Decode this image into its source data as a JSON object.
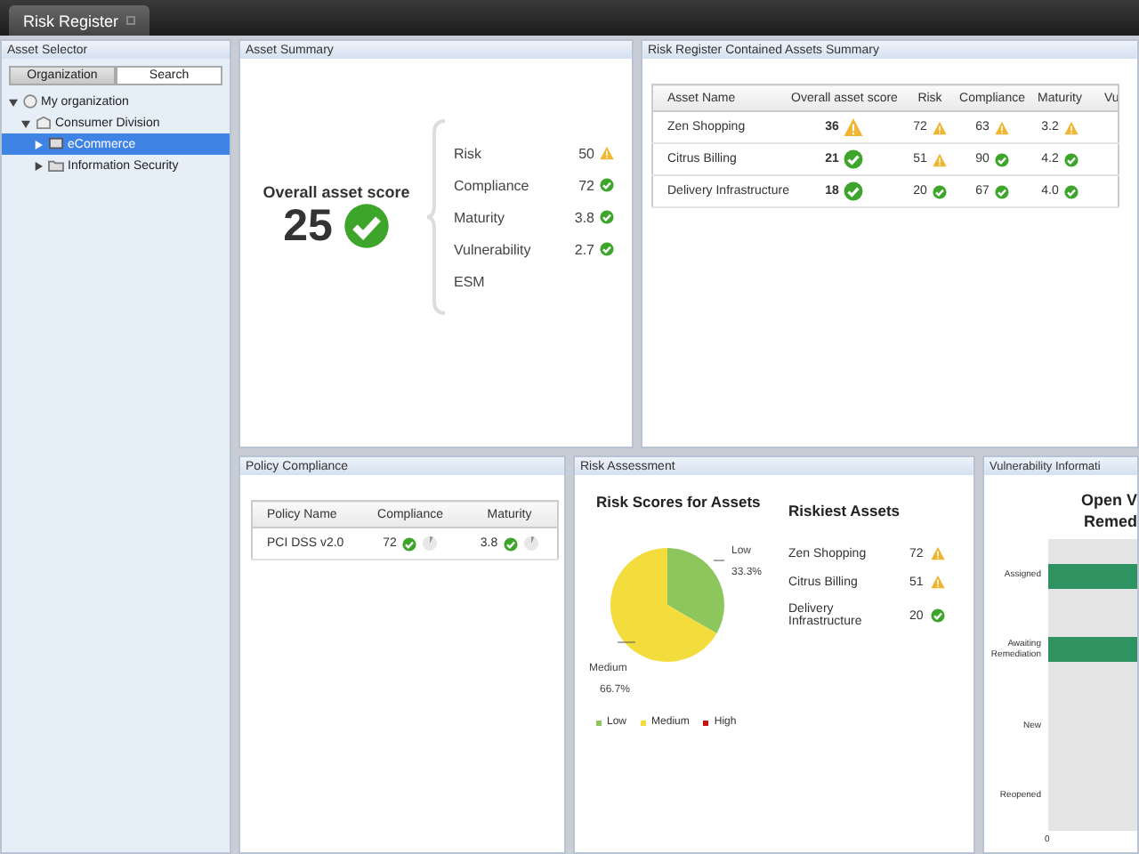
{
  "app_tabs": [
    {
      "label": "Risk Register",
      "selected": true
    }
  ],
  "asset_selector": {
    "title": "Asset Selector",
    "tabs": [
      {
        "label": "Organization",
        "selected": true
      },
      {
        "label": "Search",
        "selected": false
      }
    ],
    "tree": [
      {
        "label": "My organization",
        "kind": "org",
        "expanded": true,
        "selected": false,
        "children": [
          {
            "label": "Consumer Division",
            "kind": "division",
            "expanded": true,
            "selected": false,
            "children": [
              {
                "label": "eCommerce",
                "kind": "asset",
                "expanded": false,
                "selected": true
              },
              {
                "label": "Information Security",
                "kind": "folder",
                "expanded": false,
                "selected": false
              }
            ]
          }
        ]
      }
    ]
  },
  "asset_summary": {
    "title": "Asset Summary",
    "score_label": "Overall asset score",
    "score": "25",
    "warning": false,
    "metrics": [
      {
        "name": "Risk",
        "value": "50",
        "warning": true
      },
      {
        "name": "Compliance",
        "value": "72",
        "warning": false
      },
      {
        "name": "Maturity",
        "value": "3.8",
        "warning": false
      },
      {
        "name": "Vulnerability",
        "value": "2.7",
        "warning": false
      },
      {
        "name": "ESM"
      }
    ]
  },
  "contained_assets": {
    "title": "Risk Register Contained Assets Summary",
    "columns": [
      "Asset Name",
      "Overall asset score",
      "Risk",
      "Compliance",
      "Maturity",
      "Vu"
    ],
    "rows": [
      {
        "cells": [
          {
            "value": "Zen Shopping"
          },
          {
            "value": "36",
            "warning": true
          },
          {
            "value": "72",
            "warning": true
          },
          {
            "value": "63",
            "warning": true
          },
          {
            "value": "3.2",
            "warning": true
          }
        ]
      },
      {
        "cells": [
          {
            "value": "Citrus Billing"
          },
          {
            "value": "21",
            "warning": false
          },
          {
            "value": "51",
            "warning": true
          },
          {
            "value": "90",
            "warning": false
          },
          {
            "value": "4.2",
            "warning": false
          }
        ]
      },
      {
        "cells": [
          {
            "value": "Delivery Infrastructure"
          },
          {
            "value": "18",
            "warning": false
          },
          {
            "value": "20",
            "warning": false
          },
          {
            "value": "67",
            "warning": false
          },
          {
            "value": "4.0",
            "warning": false
          }
        ]
      }
    ]
  },
  "policy_compliance": {
    "title": "Policy Compliance",
    "columns": [
      "Policy Name",
      "Compliance",
      "Maturity"
    ],
    "rows": [
      {
        "cells": [
          {
            "value": "PCI DSS v2.0"
          },
          {
            "value": "72",
            "warning": false
          },
          {
            "value": "3.8",
            "warning": false
          }
        ]
      }
    ]
  },
  "risk_assessment": {
    "title": "Risk Assessment",
    "chart_data": {
      "type": "pie",
      "title": "Risk Scores for Assets",
      "categories": [
        "Low",
        "Medium",
        "High"
      ],
      "values": [
        33.3,
        66.7,
        0
      ],
      "value_labels": [
        "33.3%",
        "66.7%",
        null
      ]
    },
    "legend": [
      {
        "color": "#8cc65c"
      },
      {
        "color": "#f3dd3c"
      },
      {
        "color": "#cc1111"
      }
    ],
    "riskiest_title": "Riskiest Assets",
    "riskiest": [
      {
        "name": "Zen Shopping",
        "value": "72",
        "warning": true
      },
      {
        "name": "Citrus Billing",
        "value": "51",
        "warning": true
      },
      {
        "name": "Delivery Infrastructure",
        "value": "20",
        "warning": false
      }
    ]
  },
  "vulnerability": {
    "title": "Vulnerability Informati",
    "heading": [
      "Open V",
      "Remed"
    ],
    "bars": [
      {
        "label": "Assigned",
        "bar": true
      },
      {
        "label": "Awaiting Remediation",
        "bar": true
      },
      {
        "label": "New",
        "bar": false
      },
      {
        "label": "Reopened",
        "bar": false
      }
    ],
    "axis_label": "0"
  }
}
